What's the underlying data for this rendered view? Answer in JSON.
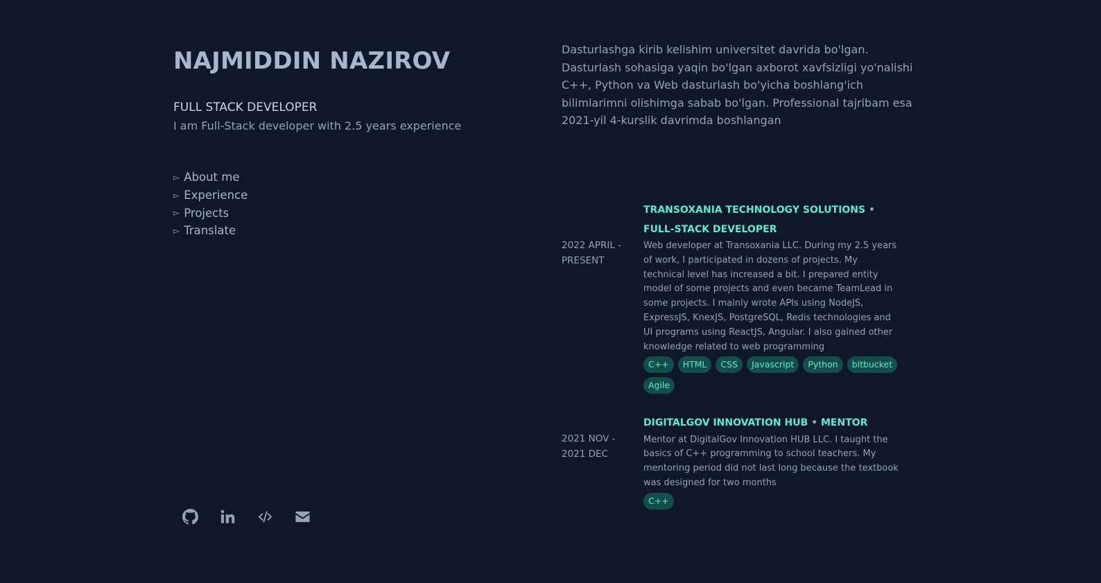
{
  "profile": {
    "name": "NAJMIDDIN NAZIROV",
    "role": "FULL STACK DEVELOPER",
    "tagline": "I am Full-Stack developer with 2.5 years experience"
  },
  "nav": {
    "items": [
      {
        "label": "About me"
      },
      {
        "label": "Experience"
      },
      {
        "label": "Projects"
      },
      {
        "label": "Translate"
      }
    ]
  },
  "social": {
    "icons": [
      "github-icon",
      "linkedin-icon",
      "code-icon",
      "envelope-icon"
    ]
  },
  "about": {
    "text": "Dasturlashga kirib kelishim universitet davrida bo'lgan. Dasturlash sohasiga yaqin bo'lgan axborot xavfsizligi yo'nalishi C++, Python va Web dasturlash bo'yicha boshlang'ich bilimlarimni olishimga sabab bo'lgan. Professional tajribam esa 2021-yil 4-kurslik davrimda boshlangan"
  },
  "experience": [
    {
      "date": "2022 April - Present",
      "company": "Transoxania Technology Solutions",
      "separator": "•",
      "position": "Full-Stack Developer",
      "description": "Web developer at Transoxania LLC. During my 2.5 years of work, I participated in dozens of projects. My technical level has increased a bit. I prepared entity model of some projects and even became TeamLead in some projects. I mainly wrote APIs using NodeJS, ExpressJS, KnexJS, PostgreSQL, Redis technologies and UI programs using ReactJS, Angular. I also gained other knowledge related to web programming",
      "tags": [
        "C++",
        "HTML",
        "CSS",
        "Javascript",
        "Python",
        "bitbucket",
        "Agile"
      ]
    },
    {
      "date": "2021 Nov - 2021 Dec",
      "company": "DigitalGov Innovation Hub",
      "separator": "•",
      "position": "Mentor",
      "description": "Mentor at DigitalGov Innovation HUB LLC. I taught the basics of C++ programming to school teachers. My mentoring period did not last long because the textbook was designed for two months",
      "tags": [
        "C++"
      ]
    }
  ],
  "colors": {
    "background": "#0f172a",
    "text": "#94a3b8",
    "heading": "#a8b6cc",
    "accent": "#5eead4",
    "tag_bg": "#134e4a"
  }
}
